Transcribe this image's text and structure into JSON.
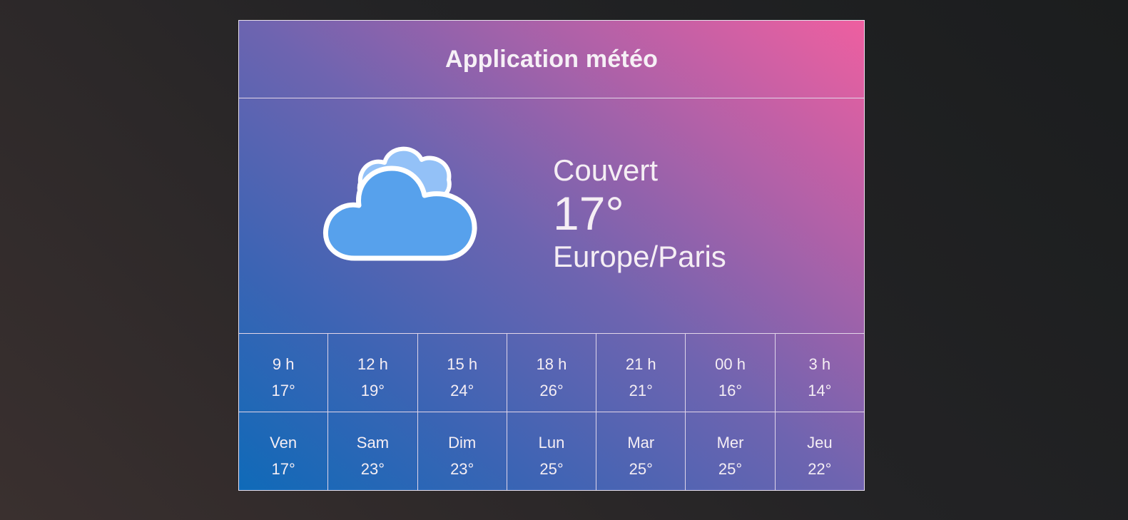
{
  "header": {
    "title": "Application météo"
  },
  "current": {
    "icon": "cloudy-icon",
    "description": "Couvert",
    "temperature": "17°",
    "location": "Europe/Paris"
  },
  "hourly": [
    {
      "label": "9 h",
      "temp": "17°"
    },
    {
      "label": "12 h",
      "temp": "19°"
    },
    {
      "label": "15 h",
      "temp": "24°"
    },
    {
      "label": "18 h",
      "temp": "26°"
    },
    {
      "label": "21 h",
      "temp": "21°"
    },
    {
      "label": "00 h",
      "temp": "16°"
    },
    {
      "label": "3 h",
      "temp": "14°"
    }
  ],
  "daily": [
    {
      "label": "Ven",
      "temp": "17°"
    },
    {
      "label": "Sam",
      "temp": "23°"
    },
    {
      "label": "Dim",
      "temp": "23°"
    },
    {
      "label": "Lun",
      "temp": "25°"
    },
    {
      "label": "Mar",
      "temp": "25°"
    },
    {
      "label": "Mer",
      "temp": "25°"
    },
    {
      "label": "Jeu",
      "temp": "22°"
    }
  ],
  "colors": {
    "gradient_start": "#0f6ab8",
    "gradient_end": "#ee5fa0",
    "cloud_front": "#57a1ec",
    "cloud_back": "#93c1f7"
  }
}
